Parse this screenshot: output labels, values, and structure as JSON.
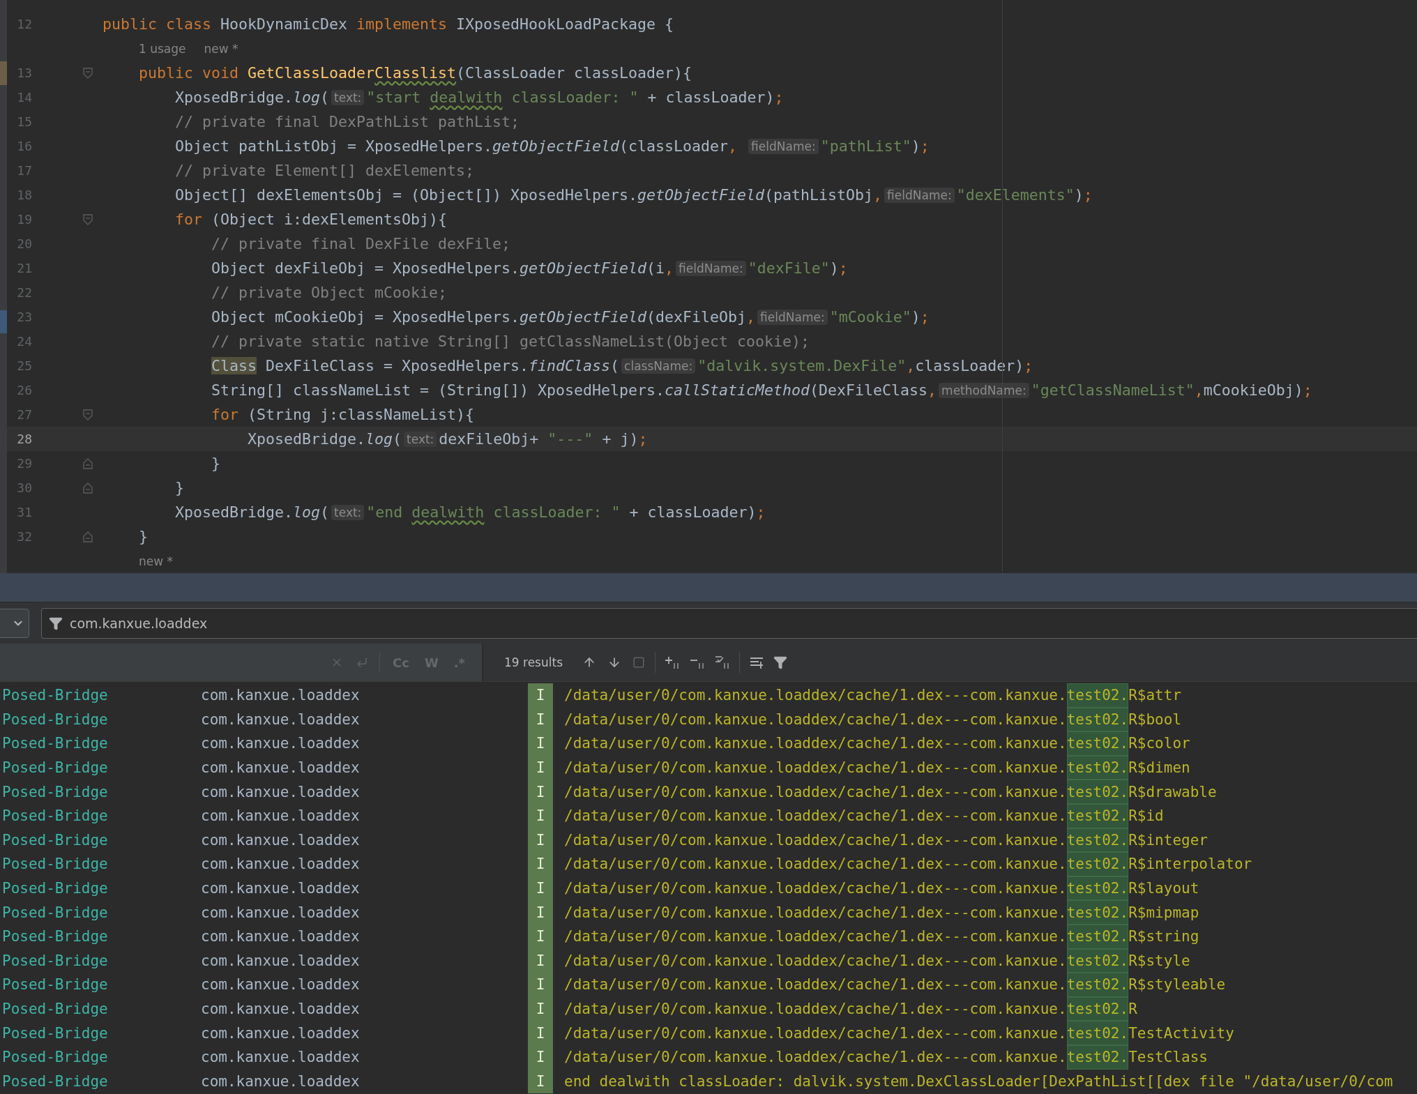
{
  "editor": {
    "rows": [
      {
        "kind": "code",
        "number": "12",
        "fold_start": false,
        "fold_end": false,
        "current": false,
        "tokens": [
          {
            "kind": "keyword",
            "text": "public"
          },
          {
            "kind": "keyword",
            "text": " class"
          },
          {
            "kind": "plain",
            "text": " HookDynamicDex "
          },
          {
            "kind": "keyword",
            "text": "implements"
          },
          {
            "kind": "plain",
            "text": " IXposedHookLoadPackage {"
          }
        ]
      },
      {
        "kind": "lens",
        "texts": [
          "1 usage",
          "new *"
        ]
      },
      {
        "kind": "code",
        "number": "13",
        "fold_start": true,
        "fold_end": false,
        "current": false,
        "tokens": [
          {
            "kind": "keyword",
            "text": "    public"
          },
          {
            "kind": "keyword",
            "text": " void"
          },
          {
            "kind": "method",
            "text": " GetClassLoader"
          },
          {
            "kind": "method-typo",
            "text": "Classlist"
          },
          {
            "kind": "plain",
            "text": "(ClassLoader classLoader){"
          }
        ]
      },
      {
        "kind": "code",
        "number": "14",
        "fold_start": false,
        "fold_end": false,
        "current": false,
        "tokens": [
          {
            "kind": "plain",
            "text": "        XposedBridge."
          },
          {
            "kind": "call",
            "text": "log"
          },
          {
            "kind": "plain",
            "text": "("
          },
          {
            "kind": "hint",
            "text": "text:"
          },
          {
            "kind": "string",
            "text": "\"start "
          },
          {
            "kind": "string-typo",
            "text": "dealwith"
          },
          {
            "kind": "string",
            "text": " classLoader: \""
          },
          {
            "kind": "plain",
            "text": " + classLoader)"
          },
          {
            "kind": "punct",
            "text": ";"
          }
        ]
      },
      {
        "kind": "code",
        "number": "15",
        "fold_start": false,
        "fold_end": false,
        "current": false,
        "tokens": [
          {
            "kind": "comment",
            "text": "        // private final DexPathList pathList;"
          }
        ]
      },
      {
        "kind": "code",
        "number": "16",
        "fold_start": false,
        "fold_end": false,
        "current": false,
        "tokens": [
          {
            "kind": "plain",
            "text": "        Object pathListObj = XposedHelpers."
          },
          {
            "kind": "call",
            "text": "getObjectField"
          },
          {
            "kind": "plain",
            "text": "(classLoader"
          },
          {
            "kind": "punct",
            "text": ", "
          },
          {
            "kind": "hint",
            "text": "fieldName:"
          },
          {
            "kind": "string",
            "text": "\"pathList\""
          },
          {
            "kind": "plain",
            "text": ")"
          },
          {
            "kind": "punct",
            "text": ";"
          }
        ]
      },
      {
        "kind": "code",
        "number": "17",
        "fold_start": false,
        "fold_end": false,
        "current": false,
        "tokens": [
          {
            "kind": "comment",
            "text": "        // private Element[] dexElements;"
          }
        ]
      },
      {
        "kind": "code",
        "number": "18",
        "fold_start": false,
        "fold_end": false,
        "current": false,
        "tokens": [
          {
            "kind": "plain",
            "text": "        Object[] dexElementsObj = (Object[]) XposedHelpers."
          },
          {
            "kind": "call",
            "text": "getObjectField"
          },
          {
            "kind": "plain",
            "text": "(pathListObj"
          },
          {
            "kind": "punct",
            "text": ","
          },
          {
            "kind": "hint",
            "text": "fieldName:"
          },
          {
            "kind": "string",
            "text": "\"dexElements\""
          },
          {
            "kind": "plain",
            "text": ")"
          },
          {
            "kind": "punct",
            "text": ";"
          }
        ]
      },
      {
        "kind": "code",
        "number": "19",
        "fold_start": true,
        "fold_end": false,
        "current": false,
        "tokens": [
          {
            "kind": "keyword",
            "text": "        for"
          },
          {
            "kind": "plain",
            "text": " (Object i:dexElementsObj){"
          }
        ]
      },
      {
        "kind": "code",
        "number": "20",
        "fold_start": false,
        "fold_end": false,
        "current": false,
        "tokens": [
          {
            "kind": "comment",
            "text": "            // private final DexFile dexFile;"
          }
        ]
      },
      {
        "kind": "code",
        "number": "21",
        "fold_start": false,
        "fold_end": false,
        "current": false,
        "tokens": [
          {
            "kind": "plain",
            "text": "            Object dexFileObj = XposedHelpers."
          },
          {
            "kind": "call",
            "text": "getObjectField"
          },
          {
            "kind": "plain",
            "text": "(i"
          },
          {
            "kind": "punct",
            "text": ","
          },
          {
            "kind": "hint",
            "text": "fieldName:"
          },
          {
            "kind": "string",
            "text": "\"dexFile\""
          },
          {
            "kind": "plain",
            "text": ")"
          },
          {
            "kind": "punct",
            "text": ";"
          }
        ]
      },
      {
        "kind": "code",
        "number": "22",
        "fold_start": false,
        "fold_end": false,
        "current": false,
        "tokens": [
          {
            "kind": "comment",
            "text": "            // private Object mCookie;"
          }
        ]
      },
      {
        "kind": "code",
        "number": "23",
        "fold_start": false,
        "fold_end": false,
        "current": false,
        "tokens": [
          {
            "kind": "plain",
            "text": "            Object mCookieObj = XposedHelpers."
          },
          {
            "kind": "call",
            "text": "getObjectField"
          },
          {
            "kind": "plain",
            "text": "(dexFileObj"
          },
          {
            "kind": "punct",
            "text": ","
          },
          {
            "kind": "hint",
            "text": "fieldName:"
          },
          {
            "kind": "string",
            "text": "\"mCookie\""
          },
          {
            "kind": "plain",
            "text": ")"
          },
          {
            "kind": "punct",
            "text": ";"
          }
        ]
      },
      {
        "kind": "code",
        "number": "24",
        "fold_start": false,
        "fold_end": false,
        "current": false,
        "tokens": [
          {
            "kind": "comment",
            "text": "            // private static native String[] getClassNameList(Object cookie);"
          }
        ]
      },
      {
        "kind": "code",
        "number": "25",
        "fold_start": false,
        "fold_end": false,
        "current": false,
        "tokens": [
          {
            "kind": "highlight",
            "text": "            Class"
          },
          {
            "kind": "plain",
            "text": " DexFileClass = XposedHelpers."
          },
          {
            "kind": "call",
            "text": "findClass"
          },
          {
            "kind": "plain",
            "text": "("
          },
          {
            "kind": "hint",
            "text": "className:"
          },
          {
            "kind": "string",
            "text": "\"dalvik.system.DexFile\""
          },
          {
            "kind": "punct",
            "text": ","
          },
          {
            "kind": "plain",
            "text": "classLoader)"
          },
          {
            "kind": "punct",
            "text": ";"
          }
        ]
      },
      {
        "kind": "code",
        "number": "26",
        "fold_start": false,
        "fold_end": false,
        "current": false,
        "tokens": [
          {
            "kind": "plain",
            "text": "            String[] classNameList = (String[]) XposedHelpers."
          },
          {
            "kind": "call",
            "text": "callStaticMethod"
          },
          {
            "kind": "plain",
            "text": "(DexFileClass"
          },
          {
            "kind": "punct",
            "text": ","
          },
          {
            "kind": "hint",
            "text": "methodName:"
          },
          {
            "kind": "string",
            "text": "\"getClassNameList\""
          },
          {
            "kind": "punct",
            "text": ","
          },
          {
            "kind": "plain",
            "text": "mCookieObj)"
          },
          {
            "kind": "punct",
            "text": ";"
          }
        ]
      },
      {
        "kind": "code",
        "number": "27",
        "fold_start": true,
        "fold_end": false,
        "current": false,
        "tokens": [
          {
            "kind": "keyword",
            "text": "            for"
          },
          {
            "kind": "plain",
            "text": " (String j:classNameList){"
          }
        ]
      },
      {
        "kind": "code",
        "number": "28",
        "fold_start": false,
        "fold_end": false,
        "current": true,
        "tokens": [
          {
            "kind": "plain",
            "text": "                XposedBridge."
          },
          {
            "kind": "call",
            "text": "log"
          },
          {
            "kind": "plain",
            "text": "("
          },
          {
            "kind": "hint",
            "text": "text:"
          },
          {
            "kind": "plain",
            "text": "dexFileObj+ "
          },
          {
            "kind": "string",
            "text": "\"---\""
          },
          {
            "kind": "plain",
            "text": " + j)"
          },
          {
            "kind": "punct",
            "text": ";"
          }
        ]
      },
      {
        "kind": "code",
        "number": "29",
        "fold_start": false,
        "fold_end": true,
        "current": false,
        "tokens": [
          {
            "kind": "plain",
            "text": "            }"
          }
        ]
      },
      {
        "kind": "code",
        "number": "30",
        "fold_start": false,
        "fold_end": true,
        "current": false,
        "tokens": [
          {
            "kind": "plain",
            "text": "        }"
          }
        ]
      },
      {
        "kind": "code",
        "number": "31",
        "fold_start": false,
        "fold_end": false,
        "current": false,
        "tokens": [
          {
            "kind": "plain",
            "text": "        XposedBridge."
          },
          {
            "kind": "call",
            "text": "log"
          },
          {
            "kind": "plain",
            "text": "("
          },
          {
            "kind": "hint",
            "text": "text:"
          },
          {
            "kind": "string",
            "text": "\"end "
          },
          {
            "kind": "string-typo",
            "text": "dealwith"
          },
          {
            "kind": "string",
            "text": " classLoader: \""
          },
          {
            "kind": "plain",
            "text": " + classLoader)"
          },
          {
            "kind": "punct",
            "text": ";"
          }
        ]
      },
      {
        "kind": "code",
        "number": "32",
        "fold_start": false,
        "fold_end": true,
        "current": false,
        "tokens": [
          {
            "kind": "plain",
            "text": "    }"
          }
        ]
      },
      {
        "kind": "lens",
        "texts": [
          "new *"
        ]
      }
    ]
  },
  "logcat": {
    "filter": {
      "value": "com.kanxue.loaddex"
    },
    "search": {
      "options": [
        {
          "label": "Cc",
          "selected": false
        },
        {
          "label": "W",
          "selected": false
        },
        {
          "label": ".*",
          "selected": false
        }
      ]
    },
    "results": "19 results",
    "rows": [
      {
        "tag": "Posed-Bridge",
        "package": "com.kanxue.loaddex",
        "level": "I",
        "segments": [
          {
            "text": "/data/user/0/com.kanxue.loaddex/cache/1.dex---com.kanxue.",
            "match": false
          },
          {
            "text": "test02.",
            "match": true
          },
          {
            "text": "R$attr",
            "match": false
          }
        ]
      },
      {
        "tag": "Posed-Bridge",
        "package": "com.kanxue.loaddex",
        "level": "I",
        "segments": [
          {
            "text": "/data/user/0/com.kanxue.loaddex/cache/1.dex---com.kanxue.",
            "match": false
          },
          {
            "text": "test02.",
            "match": true
          },
          {
            "text": "R$bool",
            "match": false
          }
        ]
      },
      {
        "tag": "Posed-Bridge",
        "package": "com.kanxue.loaddex",
        "level": "I",
        "segments": [
          {
            "text": "/data/user/0/com.kanxue.loaddex/cache/1.dex---com.kanxue.",
            "match": false
          },
          {
            "text": "test02.",
            "match": true
          },
          {
            "text": "R$color",
            "match": false
          }
        ]
      },
      {
        "tag": "Posed-Bridge",
        "package": "com.kanxue.loaddex",
        "level": "I",
        "segments": [
          {
            "text": "/data/user/0/com.kanxue.loaddex/cache/1.dex---com.kanxue.",
            "match": false
          },
          {
            "text": "test02.",
            "match": true
          },
          {
            "text": "R$dimen",
            "match": false
          }
        ]
      },
      {
        "tag": "Posed-Bridge",
        "package": "com.kanxue.loaddex",
        "level": "I",
        "segments": [
          {
            "text": "/data/user/0/com.kanxue.loaddex/cache/1.dex---com.kanxue.",
            "match": false
          },
          {
            "text": "test02.",
            "match": true
          },
          {
            "text": "R$drawable",
            "match": false
          }
        ]
      },
      {
        "tag": "Posed-Bridge",
        "package": "com.kanxue.loaddex",
        "level": "I",
        "segments": [
          {
            "text": "/data/user/0/com.kanxue.loaddex/cache/1.dex---com.kanxue.",
            "match": false
          },
          {
            "text": "test02.",
            "match": true
          },
          {
            "text": "R$id",
            "match": false
          }
        ]
      },
      {
        "tag": "Posed-Bridge",
        "package": "com.kanxue.loaddex",
        "level": "I",
        "segments": [
          {
            "text": "/data/user/0/com.kanxue.loaddex/cache/1.dex---com.kanxue.",
            "match": false
          },
          {
            "text": "test02.",
            "match": true
          },
          {
            "text": "R$integer",
            "match": false
          }
        ]
      },
      {
        "tag": "Posed-Bridge",
        "package": "com.kanxue.loaddex",
        "level": "I",
        "segments": [
          {
            "text": "/data/user/0/com.kanxue.loaddex/cache/1.dex---com.kanxue.",
            "match": false
          },
          {
            "text": "test02.",
            "match": true
          },
          {
            "text": "R$interpolator",
            "match": false
          }
        ]
      },
      {
        "tag": "Posed-Bridge",
        "package": "com.kanxue.loaddex",
        "level": "I",
        "segments": [
          {
            "text": "/data/user/0/com.kanxue.loaddex/cache/1.dex---com.kanxue.",
            "match": false
          },
          {
            "text": "test02.",
            "match": true
          },
          {
            "text": "R$layout",
            "match": false
          }
        ]
      },
      {
        "tag": "Posed-Bridge",
        "package": "com.kanxue.loaddex",
        "level": "I",
        "segments": [
          {
            "text": "/data/user/0/com.kanxue.loaddex/cache/1.dex---com.kanxue.",
            "match": false
          },
          {
            "text": "test02.",
            "match": true
          },
          {
            "text": "R$mipmap",
            "match": false
          }
        ]
      },
      {
        "tag": "Posed-Bridge",
        "package": "com.kanxue.loaddex",
        "level": "I",
        "segments": [
          {
            "text": "/data/user/0/com.kanxue.loaddex/cache/1.dex---com.kanxue.",
            "match": false
          },
          {
            "text": "test02.",
            "match": true
          },
          {
            "text": "R$string",
            "match": false
          }
        ]
      },
      {
        "tag": "Posed-Bridge",
        "package": "com.kanxue.loaddex",
        "level": "I",
        "segments": [
          {
            "text": "/data/user/0/com.kanxue.loaddex/cache/1.dex---com.kanxue.",
            "match": false
          },
          {
            "text": "test02.",
            "match": true
          },
          {
            "text": "R$style",
            "match": false
          }
        ]
      },
      {
        "tag": "Posed-Bridge",
        "package": "com.kanxue.loaddex",
        "level": "I",
        "segments": [
          {
            "text": "/data/user/0/com.kanxue.loaddex/cache/1.dex---com.kanxue.",
            "match": false
          },
          {
            "text": "test02.",
            "match": true
          },
          {
            "text": "R$styleable",
            "match": false
          }
        ]
      },
      {
        "tag": "Posed-Bridge",
        "package": "com.kanxue.loaddex",
        "level": "I",
        "segments": [
          {
            "text": "/data/user/0/com.kanxue.loaddex/cache/1.dex---com.kanxue.",
            "match": false
          },
          {
            "text": "test02.",
            "match": true
          },
          {
            "text": "R",
            "match": false
          }
        ]
      },
      {
        "tag": "Posed-Bridge",
        "package": "com.kanxue.loaddex",
        "level": "I",
        "segments": [
          {
            "text": "/data/user/0/com.kanxue.loaddex/cache/1.dex---com.kanxue.",
            "match": false
          },
          {
            "text": "test02.",
            "match": true
          },
          {
            "text": "TestActivity",
            "match": false
          }
        ]
      },
      {
        "tag": "Posed-Bridge",
        "package": "com.kanxue.loaddex",
        "level": "I",
        "segments": [
          {
            "text": "/data/user/0/com.kanxue.loaddex/cache/1.dex---com.kanxue.",
            "match": false
          },
          {
            "text": "test02.",
            "match": true
          },
          {
            "text": "TestClass",
            "match": false
          }
        ]
      },
      {
        "tag": "Posed-Bridge",
        "package": "com.kanxue.loaddex",
        "level": "I",
        "segments": [
          {
            "text": "end dealwith classLoader: dalvik.system.DexClassLoader[DexPathList[[dex file \"/data/user/0/com",
            "match": false
          }
        ]
      }
    ]
  }
}
